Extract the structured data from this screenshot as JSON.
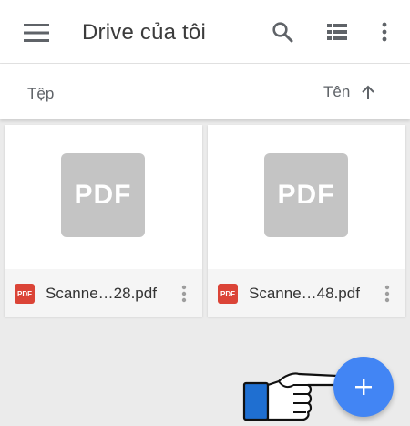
{
  "app": {
    "title": "Drive của tôi"
  },
  "icons": {
    "menu": "menu-icon",
    "search": "search-icon",
    "view_toggle": "list-view-icon",
    "more": "more-vert-icon",
    "sort_direction": "arrow-up-icon",
    "add": "plus-icon",
    "pointer": "pointing-hand-icon"
  },
  "sort_bar": {
    "section_label": "Tệp",
    "sort_label": "Tên"
  },
  "files": [
    {
      "name": "Scanne…28.pdf",
      "thumbnail_label": "PDF",
      "type_badge": "PDF"
    },
    {
      "name": "Scanne…48.pdf",
      "thumbnail_label": "PDF",
      "type_badge": "PDF"
    }
  ],
  "colors": {
    "fab": "#4285f4",
    "pdf_badge": "#db4437",
    "thumbnail_placeholder": "#c4c4c4",
    "background": "#ebebeb",
    "pointer_cuff": "#1f6fd1"
  }
}
